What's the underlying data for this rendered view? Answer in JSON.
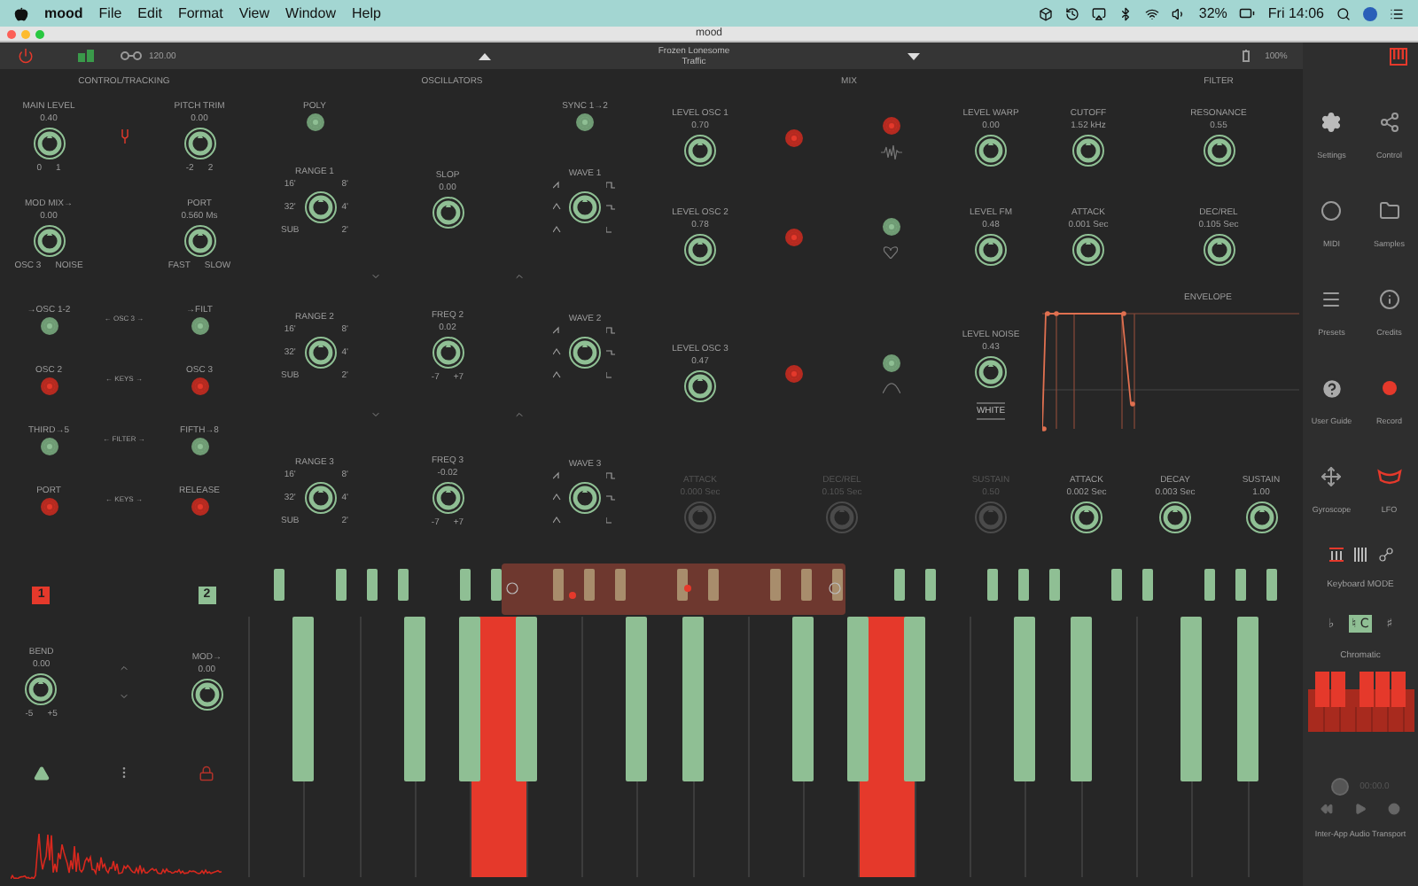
{
  "menubar": {
    "app": "mood",
    "menus": [
      "File",
      "Edit",
      "Format",
      "View",
      "Window",
      "Help"
    ],
    "battery": "32%",
    "clock": "Fri 14:06"
  },
  "window": {
    "title": "mood"
  },
  "toolbar": {
    "tempo": "120.00",
    "preset_name": "Frozen Lonesome",
    "preset_bank": "Traffic",
    "zoom": "100%"
  },
  "control_tracking": {
    "title": "CONTROL/TRACKING",
    "knobs": [
      {
        "label": "MAIN LEVEL",
        "value": "0.40",
        "scale": [
          "0",
          "1"
        ]
      },
      {
        "label": "PITCH TRIM",
        "value": "0.00",
        "scale": [
          "-2",
          "2"
        ]
      },
      {
        "label": "MOD MIX→",
        "value": "0.00",
        "scale": [
          "OSC 3",
          "NOISE"
        ]
      },
      {
        "label": "PORT",
        "value": "0.560 Ms",
        "scale": [
          "FAST",
          "SLOW"
        ]
      }
    ],
    "switch_rows": [
      {
        "left": {
          "label": "→OSC 1-2",
          "on": true
        },
        "middle": "← OSC 3 →",
        "right": {
          "label": "→FILT",
          "on": true
        }
      },
      {
        "left": {
          "label": "OSC 2",
          "on": false
        },
        "middle": "← KEYS →",
        "right": {
          "label": "OSC 3",
          "on": false
        }
      },
      {
        "left": {
          "label": "THIRD→5",
          "on": true
        },
        "middle": "← FILTER →",
        "right": {
          "label": "FIFTH→8",
          "on": true
        }
      },
      {
        "left": {
          "label": "PORT",
          "on": false
        },
        "middle": "← KEYS →",
        "right": {
          "label": "RELEASE",
          "on": false
        }
      }
    ]
  },
  "oscillators": {
    "title": "OSCILLATORS",
    "switches": [
      {
        "label": "POLY",
        "on": true
      },
      {
        "label": "SYNC 1→2",
        "on": true
      }
    ],
    "rows": [
      [
        {
          "label": "RANGE 1",
          "kind": "range",
          "scale": [
            "16'",
            "8'",
            "32'",
            "4'",
            "SUB",
            "2'"
          ]
        },
        {
          "label": "SLOP",
          "value": "0.00"
        },
        {
          "label": "WAVE 1",
          "kind": "wave"
        }
      ],
      [
        {
          "label": "RANGE 2",
          "kind": "range",
          "scale": [
            "16'",
            "8'",
            "32'",
            "4'",
            "SUB",
            "2'"
          ]
        },
        {
          "label": "FREQ 2",
          "value": "0.02",
          "scale": [
            "-7",
            "+7"
          ]
        },
        {
          "label": "WAVE 2",
          "kind": "wave"
        }
      ],
      [
        {
          "label": "RANGE 3",
          "kind": "range",
          "scale": [
            "16'",
            "8'",
            "32'",
            "4'",
            "SUB",
            "2'"
          ]
        },
        {
          "label": "FREQ 3",
          "value": "-0.02",
          "scale": [
            "-7",
            "+7"
          ]
        },
        {
          "label": "WAVE 3",
          "kind": "wave"
        }
      ]
    ]
  },
  "mix": {
    "title": "MIX",
    "noise_color": "WHITE",
    "rows": [
      {
        "source": {
          "label": "LEVEL OSC 1",
          "value": "0.70"
        },
        "switches": [
          {
            "on": false
          },
          {
            "on": false
          }
        ],
        "modifier": {
          "label": "LEVEL WARP",
          "value": "0.00"
        }
      },
      {
        "source": {
          "label": "LEVEL OSC 2",
          "value": "0.78"
        },
        "switches": [
          {
            "on": false
          },
          {
            "on": true
          }
        ],
        "modifier": {
          "label": "LEVEL FM",
          "value": "0.48"
        }
      },
      {
        "source": {
          "label": "LEVEL OSC 3",
          "value": "0.47"
        },
        "switches": [
          {
            "on": false
          },
          {
            "on": true
          }
        ],
        "modifier": {
          "label": "LEVEL NOISE",
          "value": "0.43"
        }
      }
    ]
  },
  "filter": {
    "title": "FILTER",
    "envelope_title": "ENVELOPE",
    "knobs": [
      {
        "label": "CUTOFF",
        "value": "1.52 kHz"
      },
      {
        "label": "RESONANCE",
        "value": "0.55"
      },
      {
        "label": "ATTACK",
        "value": "0.001 Sec"
      },
      {
        "label": "DEC/REL",
        "value": "0.105 Sec"
      }
    ]
  },
  "envelopes": [
    {
      "label": "ATTACK",
      "value": "0.000 Sec",
      "disabled": true
    },
    {
      "label": "DEC/REL",
      "value": "0.105 Sec",
      "disabled": true
    },
    {
      "label": "SUSTAIN",
      "value": "0.50",
      "disabled": true
    },
    {
      "label": "ATTACK",
      "value": "0.002 Sec",
      "disabled": false
    },
    {
      "label": "DECAY",
      "value": "0.003 Sec",
      "disabled": false
    },
    {
      "label": "SUSTAIN",
      "value": "1.00",
      "disabled": false
    }
  ],
  "performance": {
    "presets": [
      {
        "label": "1",
        "selected": true
      },
      {
        "label": "2",
        "selected": false
      }
    ],
    "knobs": [
      {
        "label": "BEND",
        "value": "0.00",
        "scale": [
          "-5",
          "+5"
        ]
      },
      {
        "label": "MOD→",
        "value": "0.00"
      }
    ]
  },
  "keyboard": {
    "keys": [
      {
        "pressed": false
      },
      {
        "pressed": false
      },
      {
        "pressed": false
      },
      {
        "pressed": false
      },
      {
        "pressed": true
      },
      {
        "pressed": false
      },
      {
        "pressed": false
      },
      {
        "pressed": false
      },
      {
        "pressed": false
      },
      {
        "pressed": false
      },
      {
        "pressed": false
      },
      {
        "pressed": true
      },
      {
        "pressed": false
      },
      {
        "pressed": false
      },
      {
        "pressed": false
      },
      {
        "pressed": false
      },
      {
        "pressed": false
      },
      {
        "pressed": false
      },
      {
        "pressed": false
      }
    ]
  },
  "sidebar": {
    "items": [
      {
        "label": "Settings",
        "kind": "settings"
      },
      {
        "label": "Control",
        "kind": "control"
      },
      {
        "label": "MIDI",
        "kind": "midi"
      },
      {
        "label": "Samples",
        "kind": "samples"
      },
      {
        "label": "Presets",
        "kind": "presets"
      },
      {
        "label": "Credits",
        "kind": "credits"
      },
      {
        "label": "User Guide",
        "kind": "guide"
      },
      {
        "label": "Record",
        "kind": "record"
      },
      {
        "label": "Gyroscope",
        "kind": "gyroscope"
      },
      {
        "label": "LFO",
        "kind": "lfo"
      }
    ],
    "mode_label": "Keyboard MODE",
    "accidentals": [
      {
        "label": "♭",
        "selected": false
      },
      {
        "label": "♮ C",
        "selected": true
      },
      {
        "label": "♯",
        "selected": false
      }
    ],
    "scale": "Chromatic",
    "transport_time": "00:00.0",
    "transport_label": "Inter-App Audio Transport"
  }
}
